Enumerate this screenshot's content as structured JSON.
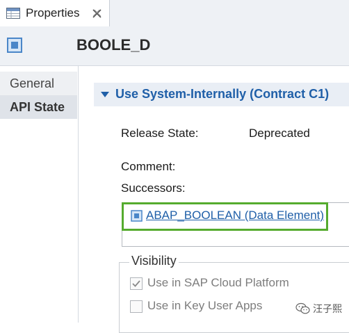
{
  "tab": {
    "label": "Properties"
  },
  "header": {
    "title": "BOOLE_D"
  },
  "nav": {
    "general": "General",
    "api_state": "API State"
  },
  "section": {
    "title": "Use System-Internally (Contract C1)",
    "release_state_label": "Release State:",
    "release_state_value": "Deprecated",
    "comment_label": "Comment:",
    "successors_label": "Successors:",
    "successor_link": "ABAP_BOOLEAN (Data Element)"
  },
  "visibility": {
    "title": "Visibility",
    "options": [
      {
        "label": "Use in SAP Cloud Platform",
        "checked": true
      },
      {
        "label": "Use in Key User Apps",
        "checked": false
      }
    ]
  },
  "watermark": {
    "text": "汪子熙"
  },
  "colors": {
    "accent": "#1f5fa8",
    "highlight_border": "#55ab2e"
  },
  "icons": {
    "tab": "properties-table-icon",
    "close": "close-icon",
    "header": "data-element-icon",
    "caret": "caret-down-icon",
    "successor": "data-element-icon",
    "check": "checkmark-icon"
  }
}
